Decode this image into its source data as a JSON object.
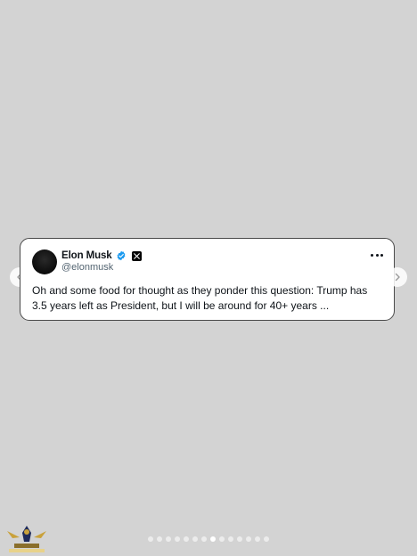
{
  "tweet": {
    "display_name": "Elon Musk",
    "handle": "@elonmusk",
    "text": "Oh and some food for thought as they ponder this question: Trump has 3.5 years left as President, but I will be around for 40+ years ..."
  },
  "carousel": {
    "total_slides": 14,
    "active_index": 7
  },
  "watermark": {
    "text": "AMAZING REPTILES FORUM"
  },
  "icons": {
    "verified": "verified-badge-icon",
    "x_logo": "x-logo-icon",
    "more": "more-options-icon",
    "prev": "chevron-left-icon",
    "next": "chevron-right-icon"
  },
  "colors": {
    "background": "#d3d3d3",
    "card": "#ffffff",
    "verified": "#1d9bf0",
    "text_primary": "#0f1419",
    "text_secondary": "#536471"
  }
}
